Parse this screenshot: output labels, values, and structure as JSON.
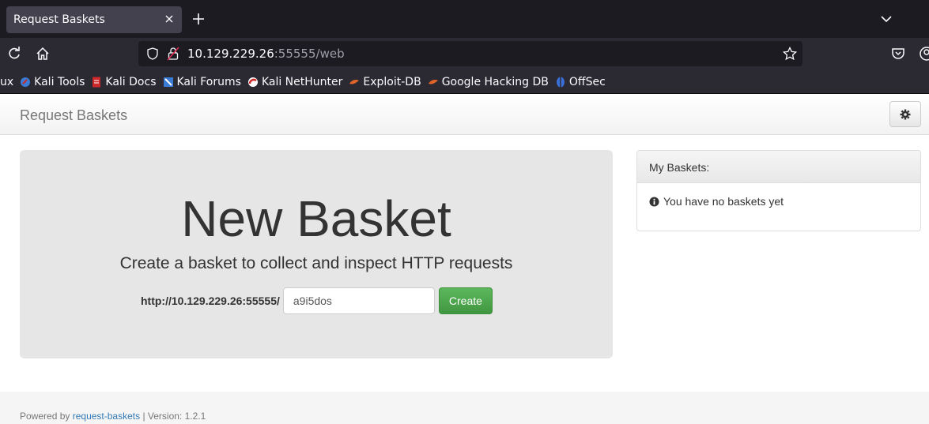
{
  "browser": {
    "tab_title": "Request Baskets",
    "url_host": "10.129.229.26",
    "url_rest": ":55555/web"
  },
  "bookmarks": [
    {
      "label": "ux",
      "icon": "bookmark-truncated-icon"
    },
    {
      "label": "Kali Tools",
      "icon": "kali-tools-icon",
      "color": "#3a7bd5"
    },
    {
      "label": "Kali Docs",
      "icon": "kali-docs-icon",
      "color": "#cc2a2a"
    },
    {
      "label": "Kali Forums",
      "icon": "kali-forums-icon",
      "color": "#3a7bd5"
    },
    {
      "label": "Kali NetHunter",
      "icon": "kali-nethunter-icon",
      "color": "#cc2a2a"
    },
    {
      "label": "Exploit-DB",
      "icon": "exploit-db-icon",
      "color": "#e0642a"
    },
    {
      "label": "Google Hacking DB",
      "icon": "ghdb-icon",
      "color": "#e0642a"
    },
    {
      "label": "OffSec",
      "icon": "offsec-icon",
      "color": "#3a6fd8"
    }
  ],
  "app": {
    "brand": "Request Baskets",
    "new_basket": {
      "title": "New Basket",
      "lead": "Create a basket to collect and inspect HTTP requests",
      "url_prefix": "http://10.129.229.26:55555/",
      "basket_name": "a9i5dos",
      "create_label": "Create"
    },
    "my_baskets": {
      "heading": "My Baskets:",
      "empty_text": "You have no baskets yet"
    },
    "footer": {
      "powered_by": "Powered by",
      "link_text": "request-baskets",
      "version_text": "| Version: 1.2.1"
    }
  },
  "colors": {
    "create_button": "#5cb85c",
    "jumbotron_bg": "#e6e6e6",
    "link": "#337ab7"
  }
}
